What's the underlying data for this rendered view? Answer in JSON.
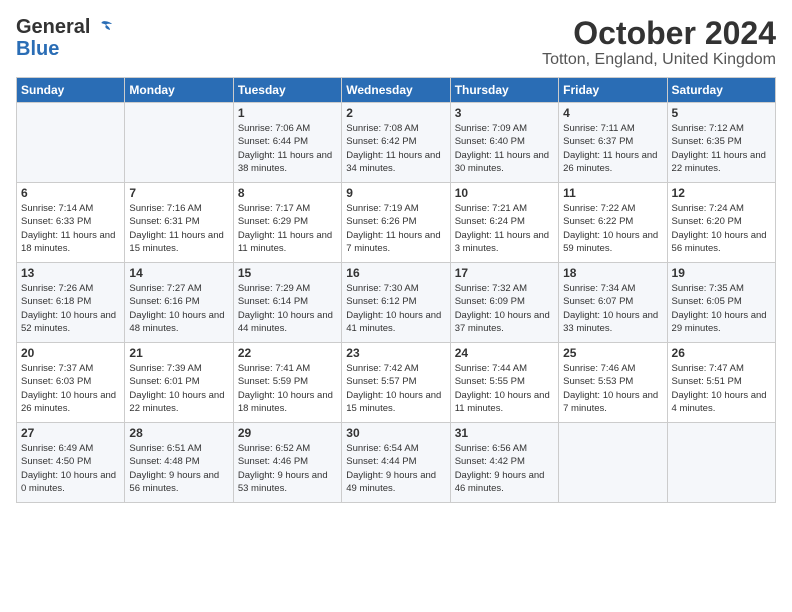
{
  "header": {
    "logo_general": "General",
    "logo_blue": "Blue",
    "month": "October 2024",
    "location": "Totton, England, United Kingdom"
  },
  "days_of_week": [
    "Sunday",
    "Monday",
    "Tuesday",
    "Wednesday",
    "Thursday",
    "Friday",
    "Saturday"
  ],
  "weeks": [
    [
      {
        "day": "",
        "text": ""
      },
      {
        "day": "",
        "text": ""
      },
      {
        "day": "1",
        "text": "Sunrise: 7:06 AM\nSunset: 6:44 PM\nDaylight: 11 hours and 38 minutes."
      },
      {
        "day": "2",
        "text": "Sunrise: 7:08 AM\nSunset: 6:42 PM\nDaylight: 11 hours and 34 minutes."
      },
      {
        "day": "3",
        "text": "Sunrise: 7:09 AM\nSunset: 6:40 PM\nDaylight: 11 hours and 30 minutes."
      },
      {
        "day": "4",
        "text": "Sunrise: 7:11 AM\nSunset: 6:37 PM\nDaylight: 11 hours and 26 minutes."
      },
      {
        "day": "5",
        "text": "Sunrise: 7:12 AM\nSunset: 6:35 PM\nDaylight: 11 hours and 22 minutes."
      }
    ],
    [
      {
        "day": "6",
        "text": "Sunrise: 7:14 AM\nSunset: 6:33 PM\nDaylight: 11 hours and 18 minutes."
      },
      {
        "day": "7",
        "text": "Sunrise: 7:16 AM\nSunset: 6:31 PM\nDaylight: 11 hours and 15 minutes."
      },
      {
        "day": "8",
        "text": "Sunrise: 7:17 AM\nSunset: 6:29 PM\nDaylight: 11 hours and 11 minutes."
      },
      {
        "day": "9",
        "text": "Sunrise: 7:19 AM\nSunset: 6:26 PM\nDaylight: 11 hours and 7 minutes."
      },
      {
        "day": "10",
        "text": "Sunrise: 7:21 AM\nSunset: 6:24 PM\nDaylight: 11 hours and 3 minutes."
      },
      {
        "day": "11",
        "text": "Sunrise: 7:22 AM\nSunset: 6:22 PM\nDaylight: 10 hours and 59 minutes."
      },
      {
        "day": "12",
        "text": "Sunrise: 7:24 AM\nSunset: 6:20 PM\nDaylight: 10 hours and 56 minutes."
      }
    ],
    [
      {
        "day": "13",
        "text": "Sunrise: 7:26 AM\nSunset: 6:18 PM\nDaylight: 10 hours and 52 minutes."
      },
      {
        "day": "14",
        "text": "Sunrise: 7:27 AM\nSunset: 6:16 PM\nDaylight: 10 hours and 48 minutes."
      },
      {
        "day": "15",
        "text": "Sunrise: 7:29 AM\nSunset: 6:14 PM\nDaylight: 10 hours and 44 minutes."
      },
      {
        "day": "16",
        "text": "Sunrise: 7:30 AM\nSunset: 6:12 PM\nDaylight: 10 hours and 41 minutes."
      },
      {
        "day": "17",
        "text": "Sunrise: 7:32 AM\nSunset: 6:09 PM\nDaylight: 10 hours and 37 minutes."
      },
      {
        "day": "18",
        "text": "Sunrise: 7:34 AM\nSunset: 6:07 PM\nDaylight: 10 hours and 33 minutes."
      },
      {
        "day": "19",
        "text": "Sunrise: 7:35 AM\nSunset: 6:05 PM\nDaylight: 10 hours and 29 minutes."
      }
    ],
    [
      {
        "day": "20",
        "text": "Sunrise: 7:37 AM\nSunset: 6:03 PM\nDaylight: 10 hours and 26 minutes."
      },
      {
        "day": "21",
        "text": "Sunrise: 7:39 AM\nSunset: 6:01 PM\nDaylight: 10 hours and 22 minutes."
      },
      {
        "day": "22",
        "text": "Sunrise: 7:41 AM\nSunset: 5:59 PM\nDaylight: 10 hours and 18 minutes."
      },
      {
        "day": "23",
        "text": "Sunrise: 7:42 AM\nSunset: 5:57 PM\nDaylight: 10 hours and 15 minutes."
      },
      {
        "day": "24",
        "text": "Sunrise: 7:44 AM\nSunset: 5:55 PM\nDaylight: 10 hours and 11 minutes."
      },
      {
        "day": "25",
        "text": "Sunrise: 7:46 AM\nSunset: 5:53 PM\nDaylight: 10 hours and 7 minutes."
      },
      {
        "day": "26",
        "text": "Sunrise: 7:47 AM\nSunset: 5:51 PM\nDaylight: 10 hours and 4 minutes."
      }
    ],
    [
      {
        "day": "27",
        "text": "Sunrise: 6:49 AM\nSunset: 4:50 PM\nDaylight: 10 hours and 0 minutes."
      },
      {
        "day": "28",
        "text": "Sunrise: 6:51 AM\nSunset: 4:48 PM\nDaylight: 9 hours and 56 minutes."
      },
      {
        "day": "29",
        "text": "Sunrise: 6:52 AM\nSunset: 4:46 PM\nDaylight: 9 hours and 53 minutes."
      },
      {
        "day": "30",
        "text": "Sunrise: 6:54 AM\nSunset: 4:44 PM\nDaylight: 9 hours and 49 minutes."
      },
      {
        "day": "31",
        "text": "Sunrise: 6:56 AM\nSunset: 4:42 PM\nDaylight: 9 hours and 46 minutes."
      },
      {
        "day": "",
        "text": ""
      },
      {
        "day": "",
        "text": ""
      }
    ]
  ]
}
